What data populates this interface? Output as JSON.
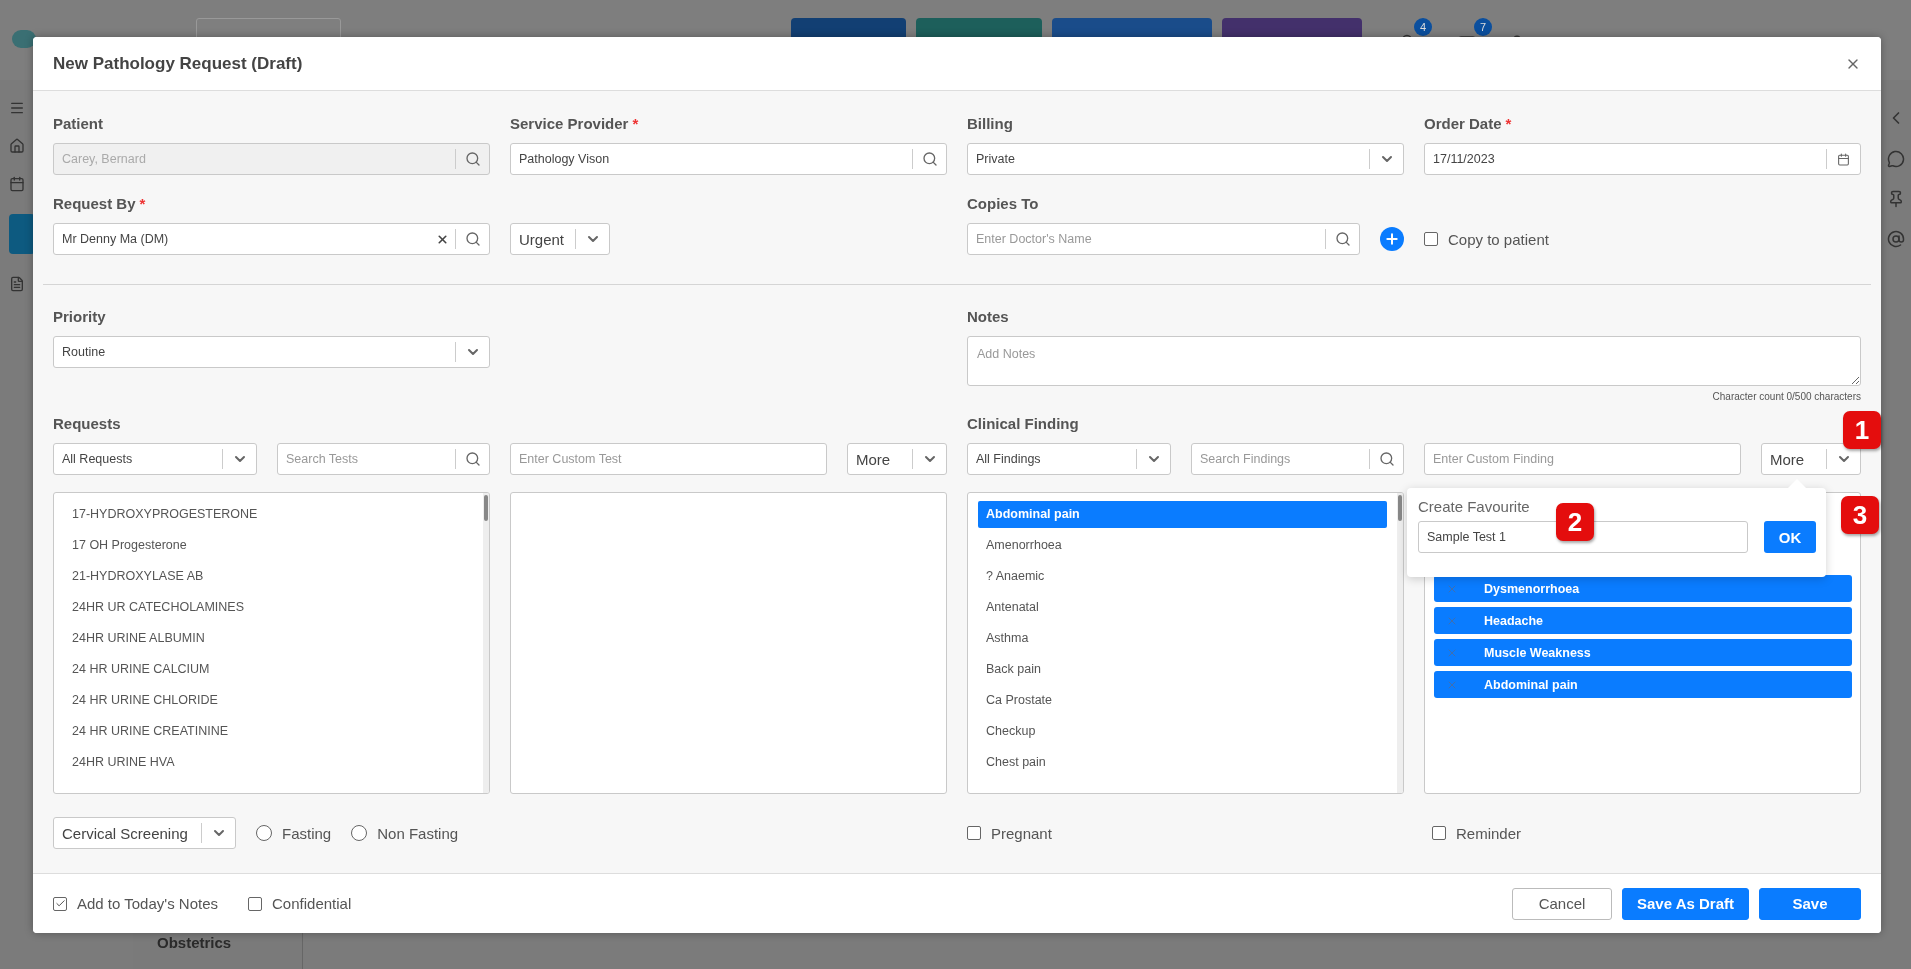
{
  "app": {
    "notification_count": "4",
    "message_count": "7",
    "section_label": "Obstetrics"
  },
  "modal": {
    "title": "New Pathology Request (Draft)"
  },
  "patient": {
    "label": "Patient",
    "value": "Carey, Bernard",
    "disabled": true
  },
  "service_provider": {
    "label": "Service Provider",
    "required_mark": "*",
    "value": "Pathology Vison"
  },
  "billing": {
    "label": "Billing",
    "value": "Private"
  },
  "order_date": {
    "label": "Order Date",
    "required_mark": "*",
    "value": "17/11/2023"
  },
  "request_by": {
    "label": "Request By",
    "required_mark": "*",
    "value": "Mr Denny Ma (DM)"
  },
  "urgency": {
    "value": "Urgent"
  },
  "copies_to": {
    "label": "Copies To",
    "placeholder": "Enter Doctor's Name"
  },
  "copy_to_patient": {
    "label": "Copy to patient",
    "checked": false
  },
  "priority": {
    "label": "Priority",
    "value": "Routine"
  },
  "notes": {
    "label": "Notes",
    "placeholder": "Add Notes",
    "char_count": "Character count 0/500 characters"
  },
  "requests": {
    "label": "Requests",
    "filter": "All Requests",
    "search_placeholder": "Search Tests",
    "custom_placeholder": "Enter Custom Test",
    "more": "More",
    "tests": [
      {
        "name": "17-HYDROXYPROGESTERONE",
        "selected": false
      },
      {
        "name": "17 OH Progesterone",
        "selected": false
      },
      {
        "name": "21-HYDROXYLASE AB",
        "selected": false
      },
      {
        "name": "24HR UR CATECHOLAMINES",
        "selected": false
      },
      {
        "name": "24HR URINE ALBUMIN",
        "selected": false
      },
      {
        "name": "24 HR URINE CALCIUM",
        "selected": false
      },
      {
        "name": "24 HR URINE CHLORIDE",
        "selected": false
      },
      {
        "name": "24 HR URINE CREATININE",
        "selected": false
      },
      {
        "name": "24HR URINE HVA",
        "selected": false
      }
    ]
  },
  "clinical_finding": {
    "label": "Clinical Finding",
    "filter": "All Findings",
    "search_placeholder": "Search Findings",
    "custom_placeholder": "Enter Custom Finding",
    "more": "More",
    "findings": [
      {
        "name": "Abdominal pain",
        "selected": true
      },
      {
        "name": "Amenorrhoea",
        "selected": false
      },
      {
        "name": "? Anaemic",
        "selected": false
      },
      {
        "name": "Antenatal",
        "selected": false
      },
      {
        "name": "Asthma",
        "selected": false
      },
      {
        "name": "Back pain",
        "selected": false
      },
      {
        "name": "Ca Prostate",
        "selected": false
      },
      {
        "name": "Checkup",
        "selected": false
      },
      {
        "name": "Chest pain",
        "selected": false
      }
    ],
    "chosen": [
      "Dysmenorrhoea",
      "Headache",
      "Muscle Weakness",
      "Abdominal pain"
    ]
  },
  "favourite_popover": {
    "title": "Create Favourite",
    "value": "Sample Test 1",
    "button": "OK"
  },
  "cervical_screening": {
    "value": "Cervical Screening"
  },
  "fasting_options": [
    {
      "label": "Fasting",
      "selected": false
    },
    {
      "label": "Non Fasting",
      "selected": false
    }
  ],
  "pregnant": {
    "label": "Pregnant",
    "checked": false
  },
  "reminder": {
    "label": "Reminder",
    "checked": false
  },
  "footer": {
    "add_to_notes": {
      "label": "Add to Today's Notes",
      "checked": true
    },
    "confidential": {
      "label": "Confidential",
      "checked": false
    },
    "buttons": [
      {
        "label": "Cancel",
        "kind": "secondary"
      },
      {
        "label": "Save As Draft",
        "kind": "primary"
      },
      {
        "label": "Save",
        "kind": "primary"
      }
    ]
  },
  "callouts": [
    "1",
    "2",
    "3"
  ]
}
